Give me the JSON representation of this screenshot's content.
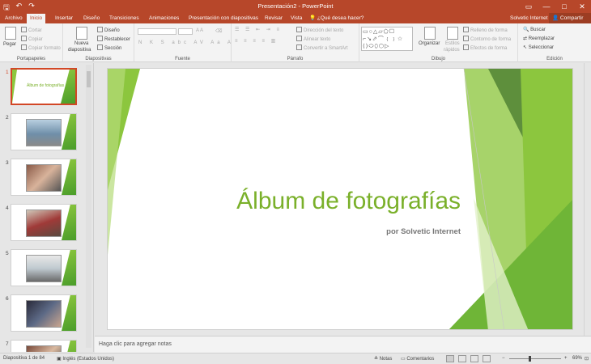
{
  "titlebar": {
    "title": "Presentación2 - PowerPoint",
    "save_icon": "save-icon",
    "undo_icon": "undo-icon",
    "redo_icon": "redo-icon",
    "minimize": "—",
    "maximize": "□",
    "close": "✕"
  },
  "tabs": [
    "Archivo",
    "Inicio",
    "Insertar",
    "Diseño",
    "Transiciones",
    "Animaciones",
    "Presentación con diapositivas",
    "Revisar",
    "Vista"
  ],
  "active_tab": "Inicio",
  "tellme": "¿Qué desea hacer?",
  "user": "Solvetic Internet",
  "share": "Compartir",
  "ribbon": {
    "portapapeles": {
      "label": "Portapapeles",
      "pegar": "Pegar",
      "cortar": "Cortar",
      "copiar": "Copiar",
      "copiar_formato": "Copiar formato"
    },
    "diapositivas": {
      "label": "Diapositivas",
      "nueva": "Nueva",
      "nueva2": "diapositiva",
      "diseno": "Diseño",
      "restablecer": "Restablecer",
      "seccion": "Sección"
    },
    "fuente": {
      "label": "Fuente"
    },
    "parrafo": {
      "label": "Párrafo",
      "direccion": "Dirección del texto",
      "alinear": "Alinear texto",
      "convertir": "Convertir a SmartArt"
    },
    "dibujo": {
      "label": "Dibujo",
      "organizar": "Organizar",
      "estilos": "Estilos",
      "rapidos": "rápidos",
      "relleno": "Relleno de forma",
      "contorno": "Contorno de forma",
      "efectos": "Efectos de forma"
    },
    "edicion": {
      "label": "Edición",
      "buscar": "Buscar",
      "reemplazar": "Reemplazar",
      "seleccionar": "Seleccionar"
    }
  },
  "thumbnails": [
    {
      "num": "1",
      "title": "Álbum de fotografías"
    },
    {
      "num": "2"
    },
    {
      "num": "3"
    },
    {
      "num": "4"
    },
    {
      "num": "5"
    },
    {
      "num": "6"
    },
    {
      "num": "7"
    }
  ],
  "slide": {
    "title": "Álbum de fotografías",
    "subtitle": "por Solvetic Internet",
    "colors": {
      "accent": "#7ab02a",
      "dark_green": "#4a9d2a"
    }
  },
  "notes_placeholder": "Haga clic para agregar notas",
  "status": {
    "slide_of": "Diapositiva 1 de 84",
    "language": "Inglés (Estados Unidos)",
    "notes": "Notas",
    "comments": "Comentarios",
    "zoom": "69%",
    "zoom_level": 0.69
  }
}
